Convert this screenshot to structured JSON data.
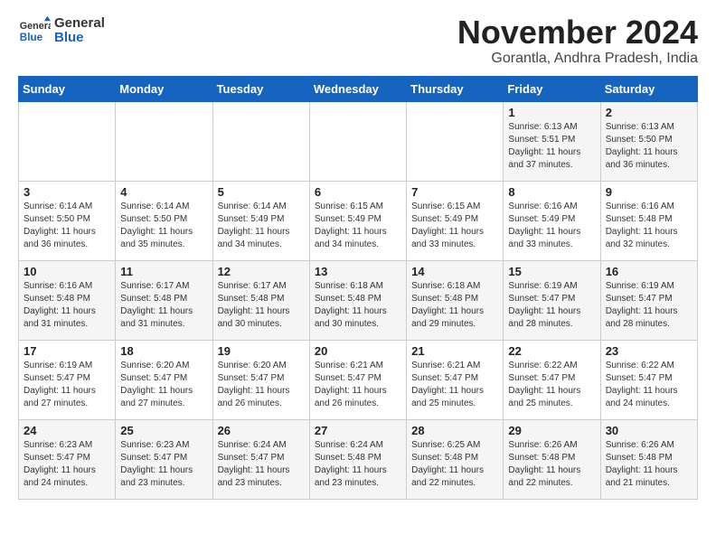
{
  "header": {
    "logo": {
      "general": "General",
      "blue": "Blue"
    },
    "title": "November 2024",
    "location": "Gorantla, Andhra Pradesh, India"
  },
  "weekdays": [
    "Sunday",
    "Monday",
    "Tuesday",
    "Wednesday",
    "Thursday",
    "Friday",
    "Saturday"
  ],
  "weeks": [
    [
      {
        "day": "",
        "info": ""
      },
      {
        "day": "",
        "info": ""
      },
      {
        "day": "",
        "info": ""
      },
      {
        "day": "",
        "info": ""
      },
      {
        "day": "",
        "info": ""
      },
      {
        "day": "1",
        "info": "Sunrise: 6:13 AM\nSunset: 5:51 PM\nDaylight: 11 hours\nand 37 minutes."
      },
      {
        "day": "2",
        "info": "Sunrise: 6:13 AM\nSunset: 5:50 PM\nDaylight: 11 hours\nand 36 minutes."
      }
    ],
    [
      {
        "day": "3",
        "info": "Sunrise: 6:14 AM\nSunset: 5:50 PM\nDaylight: 11 hours\nand 36 minutes."
      },
      {
        "day": "4",
        "info": "Sunrise: 6:14 AM\nSunset: 5:50 PM\nDaylight: 11 hours\nand 35 minutes."
      },
      {
        "day": "5",
        "info": "Sunrise: 6:14 AM\nSunset: 5:49 PM\nDaylight: 11 hours\nand 34 minutes."
      },
      {
        "day": "6",
        "info": "Sunrise: 6:15 AM\nSunset: 5:49 PM\nDaylight: 11 hours\nand 34 minutes."
      },
      {
        "day": "7",
        "info": "Sunrise: 6:15 AM\nSunset: 5:49 PM\nDaylight: 11 hours\nand 33 minutes."
      },
      {
        "day": "8",
        "info": "Sunrise: 6:16 AM\nSunset: 5:49 PM\nDaylight: 11 hours\nand 33 minutes."
      },
      {
        "day": "9",
        "info": "Sunrise: 6:16 AM\nSunset: 5:48 PM\nDaylight: 11 hours\nand 32 minutes."
      }
    ],
    [
      {
        "day": "10",
        "info": "Sunrise: 6:16 AM\nSunset: 5:48 PM\nDaylight: 11 hours\nand 31 minutes."
      },
      {
        "day": "11",
        "info": "Sunrise: 6:17 AM\nSunset: 5:48 PM\nDaylight: 11 hours\nand 31 minutes."
      },
      {
        "day": "12",
        "info": "Sunrise: 6:17 AM\nSunset: 5:48 PM\nDaylight: 11 hours\nand 30 minutes."
      },
      {
        "day": "13",
        "info": "Sunrise: 6:18 AM\nSunset: 5:48 PM\nDaylight: 11 hours\nand 30 minutes."
      },
      {
        "day": "14",
        "info": "Sunrise: 6:18 AM\nSunset: 5:48 PM\nDaylight: 11 hours\nand 29 minutes."
      },
      {
        "day": "15",
        "info": "Sunrise: 6:19 AM\nSunset: 5:47 PM\nDaylight: 11 hours\nand 28 minutes."
      },
      {
        "day": "16",
        "info": "Sunrise: 6:19 AM\nSunset: 5:47 PM\nDaylight: 11 hours\nand 28 minutes."
      }
    ],
    [
      {
        "day": "17",
        "info": "Sunrise: 6:19 AM\nSunset: 5:47 PM\nDaylight: 11 hours\nand 27 minutes."
      },
      {
        "day": "18",
        "info": "Sunrise: 6:20 AM\nSunset: 5:47 PM\nDaylight: 11 hours\nand 27 minutes."
      },
      {
        "day": "19",
        "info": "Sunrise: 6:20 AM\nSunset: 5:47 PM\nDaylight: 11 hours\nand 26 minutes."
      },
      {
        "day": "20",
        "info": "Sunrise: 6:21 AM\nSunset: 5:47 PM\nDaylight: 11 hours\nand 26 minutes."
      },
      {
        "day": "21",
        "info": "Sunrise: 6:21 AM\nSunset: 5:47 PM\nDaylight: 11 hours\nand 25 minutes."
      },
      {
        "day": "22",
        "info": "Sunrise: 6:22 AM\nSunset: 5:47 PM\nDaylight: 11 hours\nand 25 minutes."
      },
      {
        "day": "23",
        "info": "Sunrise: 6:22 AM\nSunset: 5:47 PM\nDaylight: 11 hours\nand 24 minutes."
      }
    ],
    [
      {
        "day": "24",
        "info": "Sunrise: 6:23 AM\nSunset: 5:47 PM\nDaylight: 11 hours\nand 24 minutes."
      },
      {
        "day": "25",
        "info": "Sunrise: 6:23 AM\nSunset: 5:47 PM\nDaylight: 11 hours\nand 23 minutes."
      },
      {
        "day": "26",
        "info": "Sunrise: 6:24 AM\nSunset: 5:47 PM\nDaylight: 11 hours\nand 23 minutes."
      },
      {
        "day": "27",
        "info": "Sunrise: 6:24 AM\nSunset: 5:48 PM\nDaylight: 11 hours\nand 23 minutes."
      },
      {
        "day": "28",
        "info": "Sunrise: 6:25 AM\nSunset: 5:48 PM\nDaylight: 11 hours\nand 22 minutes."
      },
      {
        "day": "29",
        "info": "Sunrise: 6:26 AM\nSunset: 5:48 PM\nDaylight: 11 hours\nand 22 minutes."
      },
      {
        "day": "30",
        "info": "Sunrise: 6:26 AM\nSunset: 5:48 PM\nDaylight: 11 hours\nand 21 minutes."
      }
    ]
  ]
}
